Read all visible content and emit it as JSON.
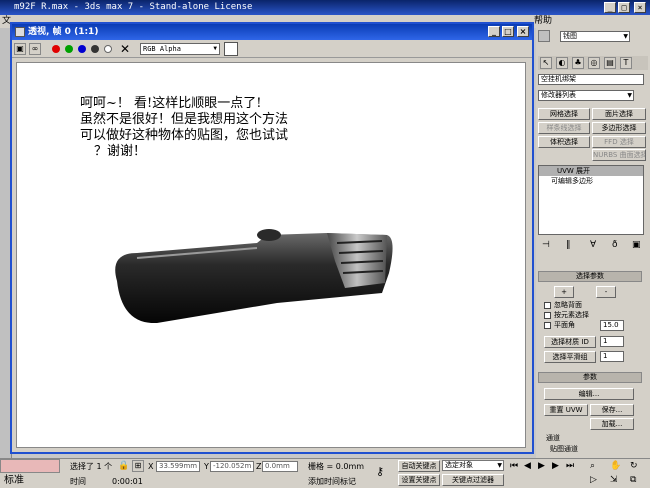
{
  "app": {
    "title": "m92F R.max - 3ds max 7 - Stand-alone License",
    "menu_left": "文",
    "menu_help": "帮助"
  },
  "viewport": {
    "title": "透视, 帧 0 (1:1)",
    "channel": "RGB Alpha",
    "note_lines": [
      "呵呵~！ 看!这样比顺眼一点了!",
      "虽然不是很好！但是我想用这个方法",
      "可以做好这种物体的贴图，您也试试",
      "？谢谢！"
    ]
  },
  "panel": {
    "object_name": "钱图",
    "modifier_list_label": "修改器列表",
    "modifier_field": "空挂机绑架",
    "buttons": {
      "mesh_select": "网格选择",
      "patch_select": "面片选择",
      "spline_select": "样条线选择",
      "poly_select": "多边形选择",
      "volume_select": "体积选择",
      "ffd_select": "FFD 选择",
      "nurbs_select": "NURBS 曲面选择"
    },
    "stack": [
      "UVW 展开",
      "可编辑多边形"
    ],
    "selection_rollout": "选择参数",
    "plus": "+",
    "minus": "-",
    "ignore_backface": "忽略背面",
    "select_by_element": "按元素选择",
    "planar_angle": "平面角",
    "planar_angle_value": "15.0",
    "select_mat_id": "选择材质 ID",
    "select_mat_id_value": "1",
    "select_smooth": "选择平滑组",
    "select_smooth_value": "1",
    "params_rollout": "参数",
    "edit_button": "编辑...",
    "reset_uvw": "重置 UVW",
    "save_button": "保存...",
    "load_button": "加载...",
    "channel_label": "通道",
    "map_channel": "贴图通道"
  },
  "status": {
    "selected": "选择了 1 个",
    "x_value": "33.599mm",
    "y_value": "-120.052m",
    "z_value": "0.0mm",
    "grid": "栅格 = 0.0mm",
    "auto_key": "自动关键点",
    "set_key": "设置关键点",
    "selected_object": "选定对象",
    "key_filter": "关键点过滤器",
    "add_time_tag": "添加时间标记",
    "time_label": "时间",
    "time_value": "0:00:01",
    "standard": "标准"
  }
}
